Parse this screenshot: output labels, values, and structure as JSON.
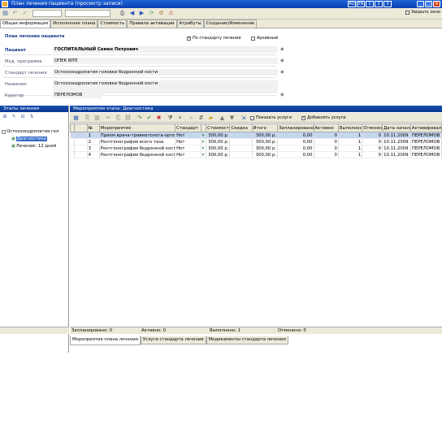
{
  "window": {
    "title": "План лечения пациента (просмотр записи)",
    "close_label": "Закрыть окно"
  },
  "tray": [
    "RU",
    "EN",
    "1",
    "2",
    "3"
  ],
  "tabs": [
    "Общая информация",
    "Исполнение плана",
    "Стоимость",
    "Правила активации",
    "Атрибуты",
    "Создание/Изменение"
  ],
  "plan": {
    "section_title": "План лечения пациента",
    "by_standard_label": "По стандарту лечения",
    "by_standard_checked": true,
    "archive_label": "Архивный",
    "archive_checked": false,
    "fields": [
      {
        "label": "Пациент",
        "value": "ГОСПИТАЛЬНЫЙ Семен Петрович",
        "bold": true
      },
      {
        "label": "Мед. программа",
        "value": "ОПЕК ВПП"
      },
      {
        "label": "Стандарт лечения",
        "value": "Остеохондропатия головки бедренной кости"
      },
      {
        "label": "Название",
        "value": "Остеохондропатия головки бедренной кости"
      },
      {
        "label": "Куратор",
        "value": "ПЕРЕЛОМОВ"
      }
    ]
  },
  "left_pane": {
    "header": "Этапы лечения",
    "tree": [
      {
        "label": "Остеохондропатия гол",
        "level": 0,
        "toggle": "-"
      },
      {
        "label": "Диагностика",
        "level": 1,
        "selected": true
      },
      {
        "label": "Лечение: 12 дней",
        "level": 1
      }
    ]
  },
  "right_pane": {
    "header": "Мероприятия этапа: Диагностика",
    "show_services_label": "Показать услуги",
    "add_services_label": "Добавлять услуги",
    "add_services_checked": true,
    "columns": [
      "",
      "",
      "№",
      "Мероприятие",
      "Стандарт",
      "",
      "Стоимость",
      "Скидка",
      "Итого",
      "Запланировано",
      "Активно",
      "Выполнено",
      "Отменено",
      "Дата начала",
      "Активировал"
    ],
    "rows": [
      [
        "",
        "",
        "1",
        "Прием врача-травматолога-ортопеда",
        "Нет",
        "",
        "300,00 р.",
        "",
        "300,00 р.",
        "0,00",
        "0",
        "1",
        "0",
        "10.11.2009",
        "ПЕРЕЛОМОВ"
      ],
      [
        "",
        "",
        "2",
        "Рентгенография всего таза",
        "Нет",
        "",
        "300,00 р.",
        "",
        "300,00 р.",
        "0,00",
        "0",
        "1",
        "0",
        "10.11.2009",
        "ПЕРЕЛОМОВ"
      ],
      [
        "",
        "",
        "3",
        "Рентгенография бедренной кости",
        "Нет",
        "",
        "300,00 р.",
        "",
        "300,00 р.",
        "0,00",
        "0",
        "1",
        "0",
        "10.11.2009",
        "ПЕРЕЛОМОВ"
      ],
      [
        "",
        "",
        "4",
        "Рентгенография бедренной кости",
        "Нет",
        "",
        "300,00 р.",
        "",
        "300,00 р.",
        "0,00",
        "0",
        "1",
        "0",
        "10.11.2009",
        "ПЕРЕЛОМОВ"
      ]
    ],
    "footer": {
      "planned": "Запланировано: 0",
      "active": "Активно: 0",
      "done": "Выполнено: 1",
      "cancelled": "Отменено: 0"
    },
    "bottom_tabs": [
      "Мероприятия плана лечения",
      "Услуги стандарта лечения",
      "Медикаменты стандарта лечения"
    ]
  },
  "colors": {
    "title_bar": "#0a3fb0",
    "selection": "#c4d7ee",
    "tree_selected": "#316ac5"
  }
}
